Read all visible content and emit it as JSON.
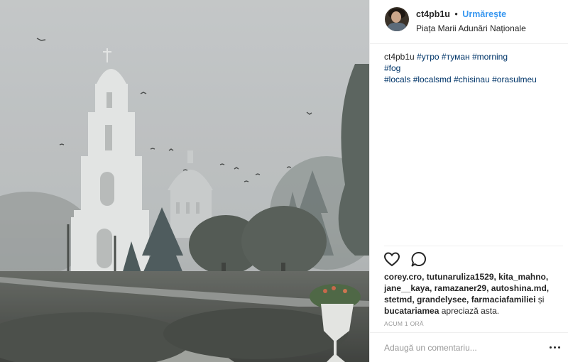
{
  "post": {
    "username": "ct4pb1u",
    "separator": "•",
    "follow_label": "Urmărește",
    "location": "Piața Marii Adunări Naționale"
  },
  "caption": {
    "username": "ct4pb1u",
    "tags": [
      "#утро",
      "#туман",
      "#morning",
      "#fog",
      "#locals",
      "#localsmd",
      "#chisinau",
      "#orasulmeu"
    ]
  },
  "actions": {
    "like_icon": "heart-icon",
    "comment_icon": "comment-icon"
  },
  "likes": {
    "users": "corey.cro, tutunaruliza1529, kita_mahno, jane__kaya, ramazaner29, autoshina.md, stetmd, grandelysee, farmaciafamiliei",
    "conjunction": "și",
    "last_user": "bucatariamea",
    "suffix": "apreciază asta."
  },
  "timestamp": "ACUM 1 ORĂ",
  "comment": {
    "placeholder": "Adaugă un comentariu..."
  },
  "colors": {
    "follow": "#3897f0",
    "hashtag": "#003569",
    "muted": "#999999",
    "border": "#efefef"
  }
}
